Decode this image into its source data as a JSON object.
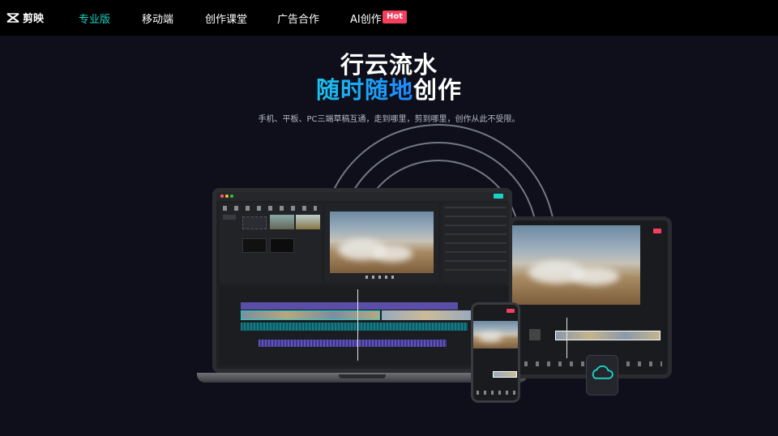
{
  "nav": {
    "logo_text": "剪映",
    "items": [
      {
        "label": "专业版",
        "active": true
      },
      {
        "label": "移动端",
        "active": false
      },
      {
        "label": "创作课堂",
        "active": false
      },
      {
        "label": "广告合作",
        "active": false
      },
      {
        "label": "AI创作",
        "active": false
      }
    ],
    "hot_badge": "Hot"
  },
  "hero": {
    "title_line1": "行云流水",
    "title_line2_highlight": "随时随地",
    "title_line2_rest": "创作",
    "subtitle": "手机、平板、PC三端草稿互通，走到哪里，剪到哪里，创作从此不受限。"
  },
  "colors": {
    "accent": "#19d3c5",
    "hot": "#f43f5e",
    "highlight_start": "#19c3f0",
    "highlight_end": "#1e88ff",
    "background": "#0e0f1a"
  },
  "icons": {
    "cloud_file": "cloud-icon",
    "logo": "capcut-logo-icon"
  }
}
